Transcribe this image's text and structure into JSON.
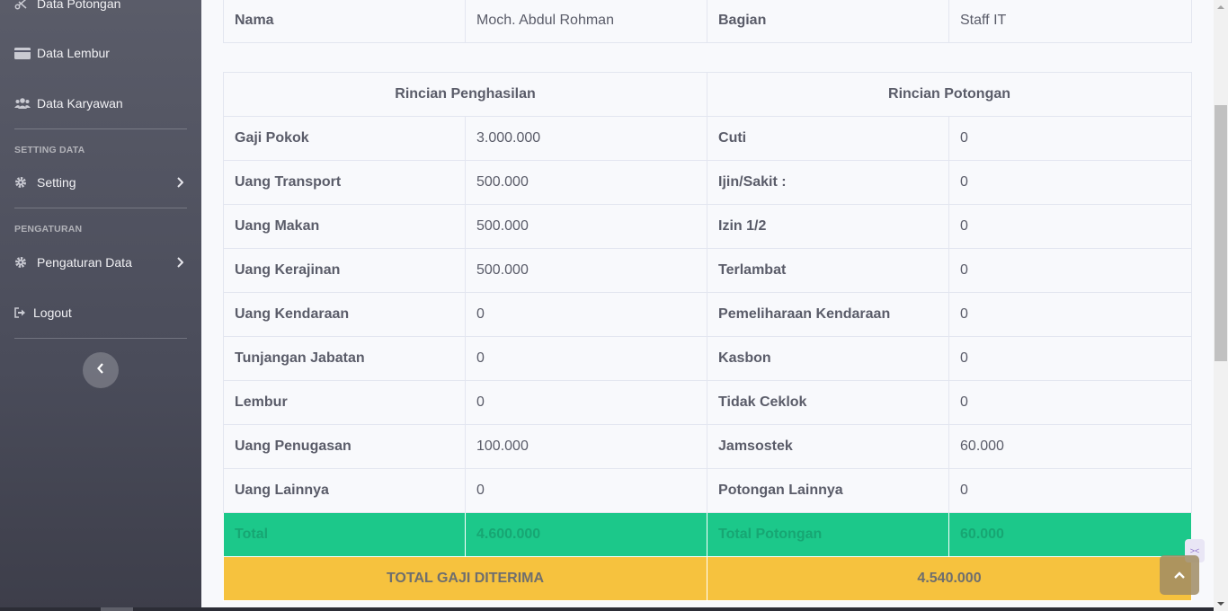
{
  "sidebar": {
    "items": [
      {
        "label": "Data Potongan",
        "icon": "scissors-icon"
      },
      {
        "label": "Data Lembur",
        "icon": "card-icon"
      },
      {
        "label": "Data Karyawan",
        "icon": "users-icon"
      },
      {
        "label": "Setting",
        "icon": "gear-icon"
      },
      {
        "label": "Pengaturan Data",
        "icon": "gear-icon"
      },
      {
        "label": "Logout",
        "icon": "logout-icon"
      }
    ],
    "headings": [
      "SETTING DATA",
      "PENGATURAN"
    ]
  },
  "employee": {
    "name_label": "Nama",
    "name_value": "Moch. Abdul Rohman",
    "dept_label": "Bagian",
    "dept_value": "Staff IT"
  },
  "details": {
    "income_header": "Rincian Penghasilan",
    "deduction_header": "Rincian Potongan",
    "rows": [
      {
        "income_label": "Gaji Pokok",
        "income_value": "3.000.000",
        "deduction_label": "Cuti",
        "deduction_value": "0"
      },
      {
        "income_label": "Uang Transport",
        "income_value": "500.000",
        "deduction_label": "Ijin/Sakit :",
        "deduction_value": "0"
      },
      {
        "income_label": "Uang Makan",
        "income_value": "500.000",
        "deduction_label": "Izin 1/2",
        "deduction_value": "0"
      },
      {
        "income_label": "Uang Kerajinan",
        "income_value": "500.000",
        "deduction_label": "Terlambat",
        "deduction_value": "0"
      },
      {
        "income_label": "Uang Kendaraan",
        "income_value": "0",
        "deduction_label": "Pemeliharaan Kendaraan",
        "deduction_value": "0"
      },
      {
        "income_label": "Tunjangan Jabatan",
        "income_value": "0",
        "deduction_label": "Kasbon",
        "deduction_value": "0"
      },
      {
        "income_label": "Lembur",
        "income_value": "0",
        "deduction_label": "Tidak Ceklok",
        "deduction_value": "0"
      },
      {
        "income_label": "Uang Penugasan",
        "income_value": "100.000",
        "deduction_label": "Jamsostek",
        "deduction_value": "60.000"
      },
      {
        "income_label": "Uang Lainnya",
        "income_value": "0",
        "deduction_label": "Potongan Lainnya",
        "deduction_value": "0"
      }
    ],
    "total": {
      "income_label": "Total",
      "income_value": "4.600.000",
      "deduction_label": "Total Potongan",
      "deduction_value": "60.000"
    },
    "grand_total": {
      "label": "TOTAL GAJI DITERIMA",
      "value": "4.540.000"
    }
  },
  "colors": {
    "sidebar": "#4e4f5c",
    "total_row": "#1cc88a",
    "grand_total_row": "#f6c23e"
  }
}
